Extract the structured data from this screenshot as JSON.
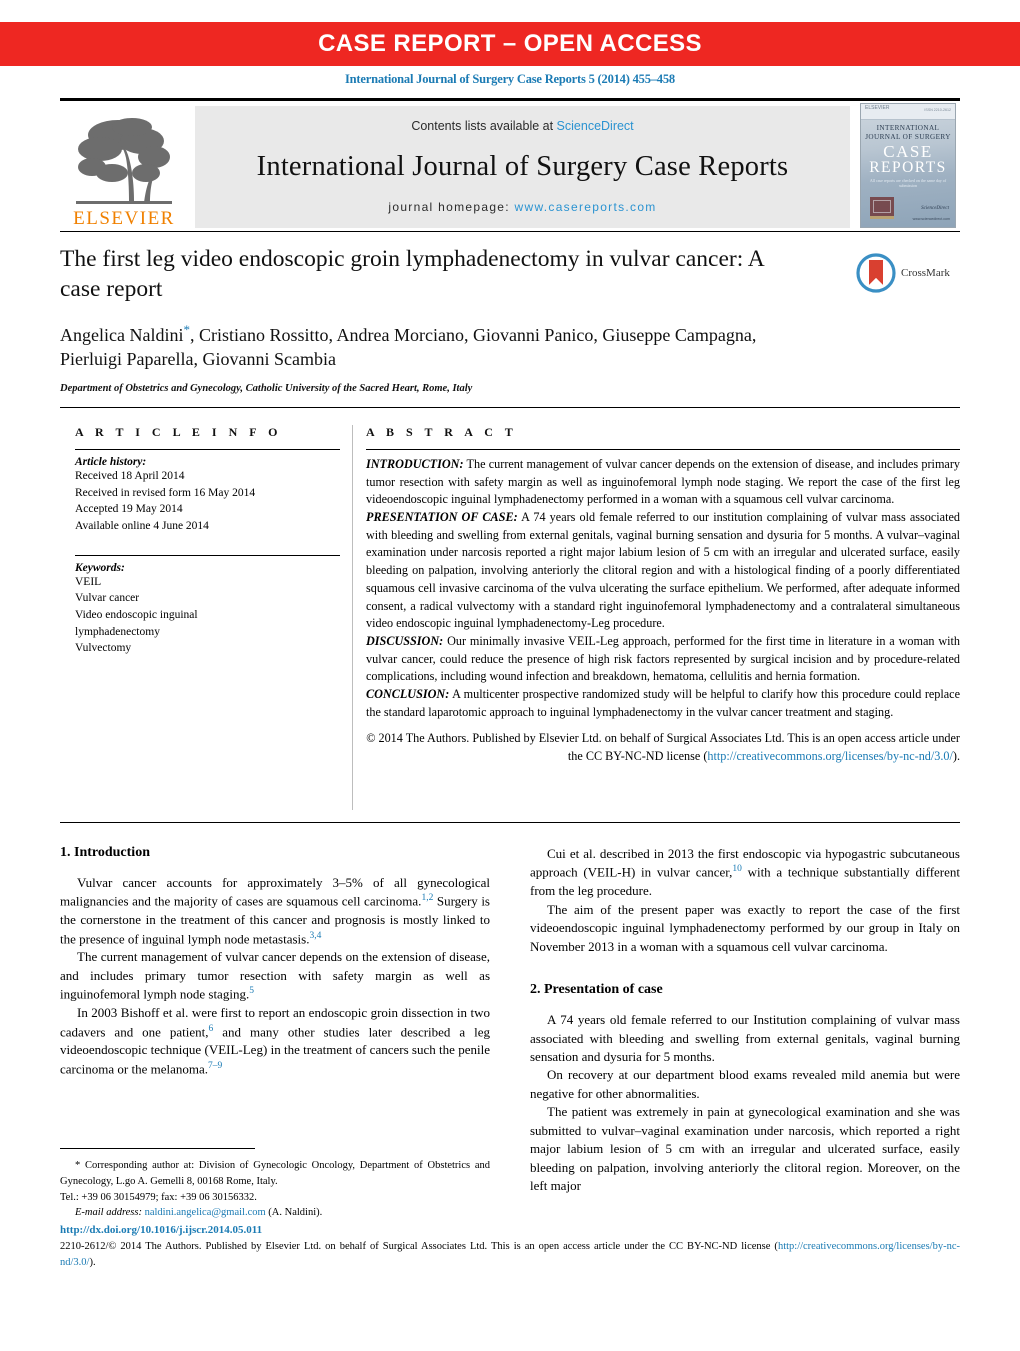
{
  "banner": {
    "text": "CASE REPORT – OPEN ACCESS",
    "color": "#ee2722"
  },
  "journal_ref": "International Journal of Surgery Case Reports 5 (2014) 455–458",
  "masthead": {
    "contents_prefix": "Contents lists available at ",
    "sciencedirect": "ScienceDirect",
    "journal_title": "International Journal of Surgery Case Reports",
    "homepage_prefix": "journal homepage: ",
    "homepage_url": "www.casereports.com",
    "publisher_word": "ELSEVIER",
    "publisher_color": "#f08000",
    "link_color": "#2b93d1",
    "cover": {
      "elsevier": "ELSEVIER",
      "issn": "ISSN 2210-2612",
      "line1": "INTERNATIONAL",
      "line2": "JOURNAL OF SURGERY",
      "big1": "CASE",
      "big2": "REPORTS",
      "subtitle": "All case reports are checked on the same day of submission",
      "sciencedirect": "ScienceDirect",
      "url": "www.sciencedirect.com"
    }
  },
  "article": {
    "title": "The first leg video endoscopic groin lymphadenectomy in vulvar cancer: A case report",
    "authors": "Angelica Naldini, Cristiano Rossitto, Andrea Morciano, Giovanni Panico, Giuseppe Campagna, Pierluigi Paparella, Giovanni Scambia",
    "corresponding_marker": "*",
    "affiliation": "Department of Obstetrics and Gynecology, Catholic University of the Sacred Heart, Rome, Italy",
    "crossmark_label": "CrossMark"
  },
  "info": {
    "heading": "A R T I C L E   I N F O",
    "history_label": "Article history:",
    "history": [
      "Received 18 April 2014",
      "Received in revised form 16 May 2014",
      "Accepted 19 May 2014",
      "Available online 4 June 2014"
    ],
    "keywords_label": "Keywords:",
    "keywords": [
      "VEIL",
      "Vulvar cancer",
      "Video endoscopic inguinal",
      "lymphadenectomy",
      "Vulvectomy"
    ]
  },
  "abstract": {
    "heading": "A B S T R A C T",
    "sections": [
      {
        "label": "INTRODUCTION:",
        "text": " The current management of vulvar cancer depends on the extension of disease, and includes primary tumor resection with safety margin as well as inguinofemoral lymph node staging. We report the case of the first leg videoendoscopic inguinal lymphadenectomy performed in a woman with a squamous cell vulvar carcinoma."
      },
      {
        "label": "PRESENTATION OF CASE:",
        "text": " A 74 years old female referred to our institution complaining of vulvar mass associated with bleeding and swelling from external genitals, vaginal burning sensation and dysuria for 5 months. A vulvar–vaginal examination under narcosis reported a right major labium lesion of 5 cm with an irregular and ulcerated surface, easily bleeding on palpation, involving anteriorly the clitoral region and with a histological finding of a poorly differentiated squamous cell invasive carcinoma of the vulva ulcerating the surface epithelium. We performed, after adequate informed consent, a radical vulvectomy with a standard right inguinofemoral lymphadenectomy and a contralateral simultaneous video endoscopic inguinal lymphadenectomy-Leg procedure."
      },
      {
        "label": "DISCUSSION:",
        "text": " Our minimally invasive VEIL-Leg approach, performed for the first time in literature in a woman with vulvar cancer, could reduce the presence of high risk factors represented by surgical incision and by procedure-related complications, including wound infection and breakdown, hematoma, cellulitis and hernia formation."
      },
      {
        "label": "CONCLUSION:",
        "text": " A multicenter prospective randomized study will be helpful to clarify how this procedure could replace the standard laparotomic approach to inguinal lymphadenectomy in the vulvar cancer treatment and staging."
      }
    ],
    "copyright_text": "© 2014 The Authors. Published by Elsevier Ltd. on behalf of Surgical Associates Ltd. This is an open access article under the CC BY-NC-ND license (",
    "copyright_link": "http://creativecommons.org/licenses/by-nc-nd/3.0/",
    "copyright_tail": ")."
  },
  "body": {
    "left": {
      "h1": "1.  Introduction",
      "p1a": "Vulvar cancer accounts for approximately 3–5% of all gynecological malignancies and the majority of cases are squamous cell carcinoma.",
      "p1ref1": "1,2",
      "p1b": " Surgery is the cornerstone in the treatment of this cancer and prognosis is mostly linked to the presence of inguinal lymph node metastasis.",
      "p1ref2": "3,4",
      "p2a": "The current management of vulvar cancer depends on the extension of disease, and includes primary tumor resection with safety margin as well as inguinofemoral lymph node staging.",
      "p2ref": "5",
      "p3a": "In 2003 Bishoff et al. were first to report an endoscopic groin dissection in two cadavers and one patient,",
      "p3ref1": "6",
      "p3b": " and many other studies later described a leg videoendoscopic technique (VEIL-Leg) in the treatment of cancers such the penile carcinoma or the melanoma.",
      "p3ref2": "7–9"
    },
    "right": {
      "p1a": "Cui et al. described in 2013 the first endoscopic via hypogastric subcutaneous approach (VEIL-H) in vulvar cancer,",
      "p1ref": "10",
      "p1b": " with a technique substantially different from the leg procedure.",
      "p2": "The aim of the present paper was exactly to report the case of the first videoendoscopic inguinal lymphadenectomy performed by our group in Italy on November 2013 in a woman with a squamous cell vulvar carcinoma.",
      "h2": "2.  Presentation of case",
      "p3": "A 74 years old female referred to our Institution complaining of vulvar mass associated with bleeding and swelling from external genitals, vaginal burning sensation and dysuria for 5 months.",
      "p4": "On recovery at our department blood exams revealed mild anemia but were negative for other abnormalities.",
      "p5": "The patient was extremely in pain at gynecological examination and she was submitted to vulvar–vaginal examination under narcosis, which reported a right major labium lesion of 5 cm with an irregular and ulcerated surface, easily bleeding on palpation, involving anteriorly the clitoral region. Moreover, on the left major"
    }
  },
  "footnotes": {
    "corresponding": "* Corresponding author at: Division of Gynecologic Oncology, Department of Obstetrics and Gynecology, L.go A. Gemelli 8, 00168 Rome, Italy.",
    "tel": "Tel.: +39 06 30154979; fax: +39 06 30156332.",
    "email_label": "E-mail address:",
    "email": "naldini.angelica@gmail.com",
    "email_attrib": "(A. Naldini).",
    "doi": "http://dx.doi.org/10.1016/j.ijscr.2014.05.011",
    "colophon_text": "2210-2612/© 2014 The Authors. Published by Elsevier Ltd. on behalf of Surgical Associates Ltd. This is an open access article under the CC BY-NC-ND license (",
    "colophon_link": "http://creativecommons.org/licenses/by-nc-nd/3.0/",
    "colophon_tail": ")."
  }
}
